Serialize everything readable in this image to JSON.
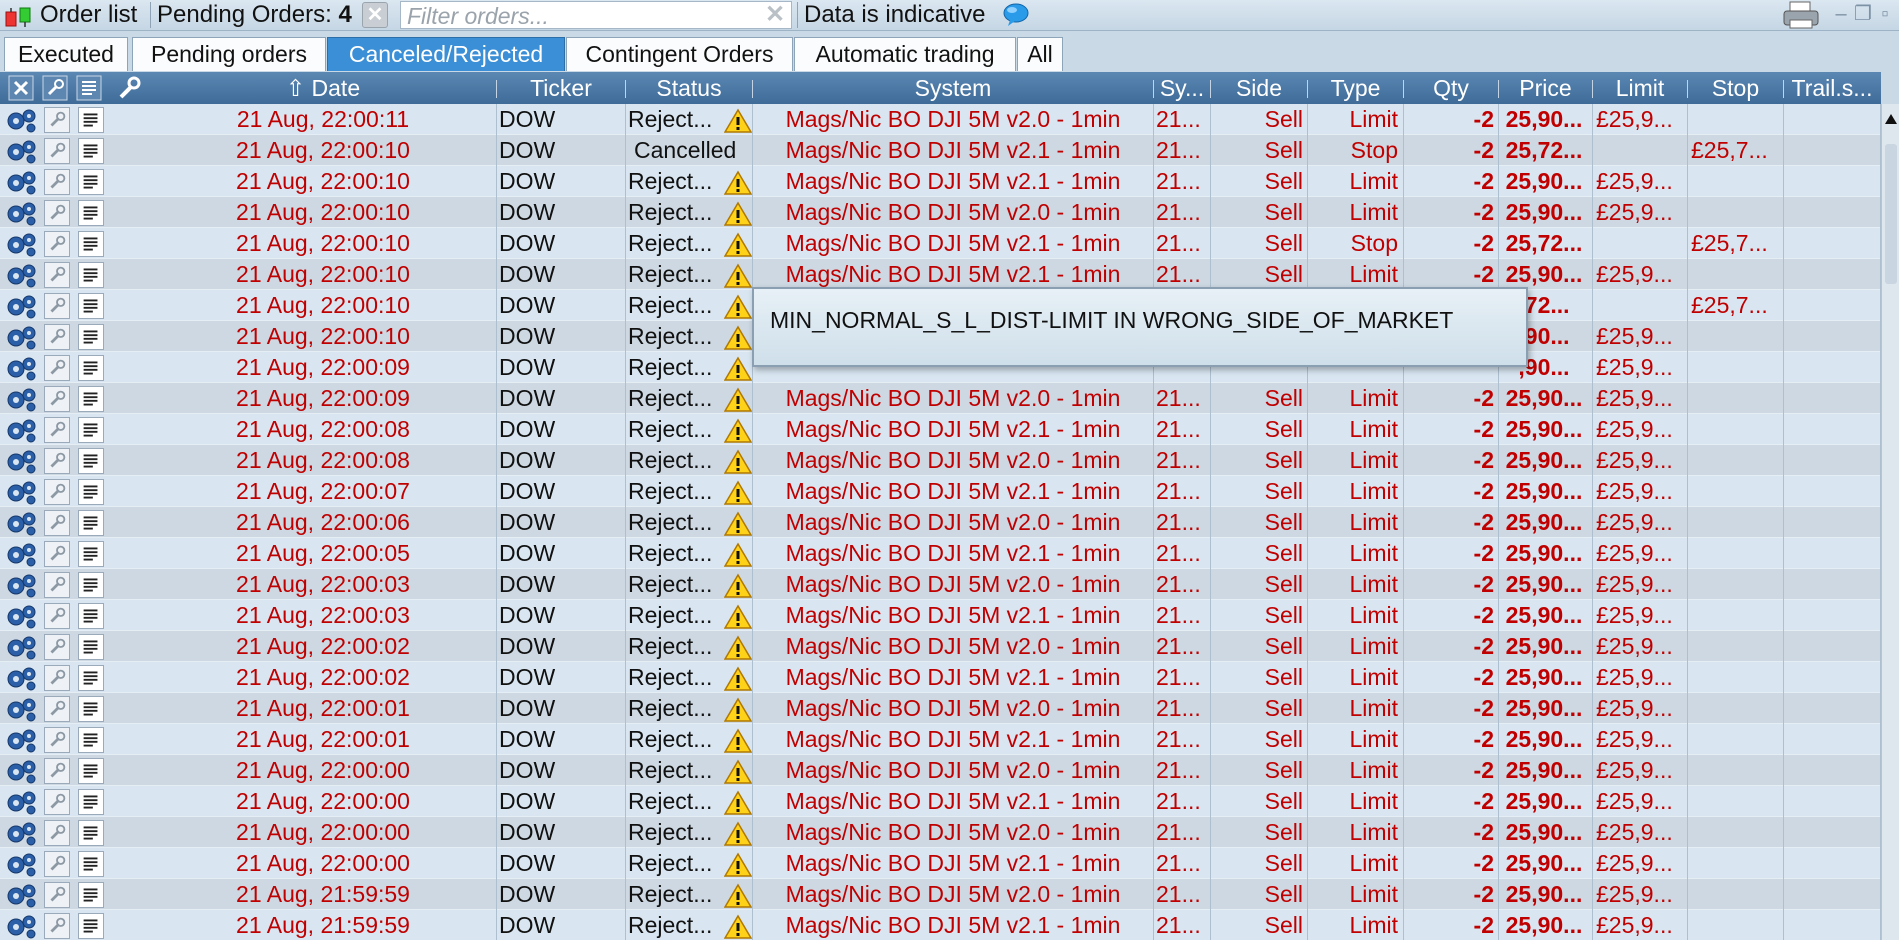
{
  "toolbar": {
    "title": "Order list",
    "pending_label": "Pending Orders:",
    "pending_count": "4",
    "filter_placeholder": "Filter orders...",
    "indicative_text": "Data is indicative"
  },
  "tabs": [
    {
      "label": "Executed",
      "active": false
    },
    {
      "label": "Pending orders",
      "active": false
    },
    {
      "label": "Canceled/Rejected",
      "active": true
    },
    {
      "label": "Contingent Orders",
      "active": false
    },
    {
      "label": "Automatic trading",
      "active": false
    },
    {
      "label": "All",
      "active": false
    }
  ],
  "columns": {
    "date": "Date",
    "ticker": "Ticker",
    "status": "Status",
    "system": "System",
    "sy": "Sy...",
    "side": "Side",
    "type": "Type",
    "qty": "Qty",
    "price": "Price",
    "limit": "Limit",
    "stop": "Stop",
    "trail": "Trail.s..."
  },
  "orders": [
    {
      "date": "21 Aug, 22:00:11",
      "ticker": "DOW",
      "status": "Reject...",
      "warn": true,
      "system": "Mags/Nic BO DJI 5M v2.0 - 1min",
      "sy": "21...",
      "side": "Sell",
      "type": "Limit",
      "qty": "-2",
      "price": "25,90...",
      "limit": "£25,9...",
      "stop": "",
      "trail": ""
    },
    {
      "date": "21 Aug, 22:00:10",
      "ticker": "DOW",
      "status": "Cancelled",
      "warn": false,
      "system": "Mags/Nic BO DJI 5M v2.1 - 1min",
      "sy": "21...",
      "side": "Sell",
      "type": "Stop",
      "qty": "-2",
      "price": "25,72...",
      "limit": "",
      "stop": "£25,7...",
      "trail": ""
    },
    {
      "date": "21 Aug, 22:00:10",
      "ticker": "DOW",
      "status": "Reject...",
      "warn": true,
      "system": "Mags/Nic BO DJI 5M v2.1 - 1min",
      "sy": "21...",
      "side": "Sell",
      "type": "Limit",
      "qty": "-2",
      "price": "25,90...",
      "limit": "£25,9...",
      "stop": "",
      "trail": ""
    },
    {
      "date": "21 Aug, 22:00:10",
      "ticker": "DOW",
      "status": "Reject...",
      "warn": true,
      "system": "Mags/Nic BO DJI 5M v2.0 - 1min",
      "sy": "21...",
      "side": "Sell",
      "type": "Limit",
      "qty": "-2",
      "price": "25,90...",
      "limit": "£25,9...",
      "stop": "",
      "trail": ""
    },
    {
      "date": "21 Aug, 22:00:10",
      "ticker": "DOW",
      "status": "Reject...",
      "warn": true,
      "system": "Mags/Nic BO DJI 5M v2.1 - 1min",
      "sy": "21...",
      "side": "Sell",
      "type": "Stop",
      "qty": "-2",
      "price": "25,72...",
      "limit": "",
      "stop": "£25,7...",
      "trail": ""
    },
    {
      "date": "21 Aug, 22:00:10",
      "ticker": "DOW",
      "status": "Reject...",
      "warn": true,
      "system": "Mags/Nic BO DJI 5M v2.1 - 1min",
      "sy": "21...",
      "side": "Sell",
      "type": "Limit",
      "qty": "-2",
      "price": "25,90...",
      "limit": "£25,9...",
      "stop": "",
      "trail": ""
    },
    {
      "date": "21 Aug, 22:00:10",
      "ticker": "DOW",
      "status": "Reject...",
      "warn": true,
      "system": "",
      "sy": "",
      "side": "",
      "type": "",
      "qty": "",
      "price": ",72...",
      "limit": "",
      "stop": "£25,7...",
      "trail": ""
    },
    {
      "date": "21 Aug, 22:00:10",
      "ticker": "DOW",
      "status": "Reject...",
      "warn": true,
      "system": "",
      "sy": "",
      "side": "",
      "type": "",
      "qty": "",
      "price": ",90...",
      "limit": "£25,9...",
      "stop": "",
      "trail": ""
    },
    {
      "date": "21 Aug, 22:00:09",
      "ticker": "DOW",
      "status": "Reject...",
      "warn": true,
      "system": "",
      "sy": "",
      "side": "",
      "type": "",
      "qty": "",
      "price": ",90...",
      "limit": "£25,9...",
      "stop": "",
      "trail": ""
    },
    {
      "date": "21 Aug, 22:00:09",
      "ticker": "DOW",
      "status": "Reject...",
      "warn": true,
      "system": "Mags/Nic BO DJI 5M v2.0 - 1min",
      "sy": "21...",
      "side": "Sell",
      "type": "Limit",
      "qty": "-2",
      "price": "25,90...",
      "limit": "£25,9...",
      "stop": "",
      "trail": ""
    },
    {
      "date": "21 Aug, 22:00:08",
      "ticker": "DOW",
      "status": "Reject...",
      "warn": true,
      "system": "Mags/Nic BO DJI 5M v2.1 - 1min",
      "sy": "21...",
      "side": "Sell",
      "type": "Limit",
      "qty": "-2",
      "price": "25,90...",
      "limit": "£25,9...",
      "stop": "",
      "trail": ""
    },
    {
      "date": "21 Aug, 22:00:08",
      "ticker": "DOW",
      "status": "Reject...",
      "warn": true,
      "system": "Mags/Nic BO DJI 5M v2.0 - 1min",
      "sy": "21...",
      "side": "Sell",
      "type": "Limit",
      "qty": "-2",
      "price": "25,90...",
      "limit": "£25,9...",
      "stop": "",
      "trail": ""
    },
    {
      "date": "21 Aug, 22:00:07",
      "ticker": "DOW",
      "status": "Reject...",
      "warn": true,
      "system": "Mags/Nic BO DJI 5M v2.1 - 1min",
      "sy": "21...",
      "side": "Sell",
      "type": "Limit",
      "qty": "-2",
      "price": "25,90...",
      "limit": "£25,9...",
      "stop": "",
      "trail": ""
    },
    {
      "date": "21 Aug, 22:00:06",
      "ticker": "DOW",
      "status": "Reject...",
      "warn": true,
      "system": "Mags/Nic BO DJI 5M v2.0 - 1min",
      "sy": "21...",
      "side": "Sell",
      "type": "Limit",
      "qty": "-2",
      "price": "25,90...",
      "limit": "£25,9...",
      "stop": "",
      "trail": ""
    },
    {
      "date": "21 Aug, 22:00:05",
      "ticker": "DOW",
      "status": "Reject...",
      "warn": true,
      "system": "Mags/Nic BO DJI 5M v2.1 - 1min",
      "sy": "21...",
      "side": "Sell",
      "type": "Limit",
      "qty": "-2",
      "price": "25,90...",
      "limit": "£25,9...",
      "stop": "",
      "trail": ""
    },
    {
      "date": "21 Aug, 22:00:03",
      "ticker": "DOW",
      "status": "Reject...",
      "warn": true,
      "system": "Mags/Nic BO DJI 5M v2.0 - 1min",
      "sy": "21...",
      "side": "Sell",
      "type": "Limit",
      "qty": "-2",
      "price": "25,90...",
      "limit": "£25,9...",
      "stop": "",
      "trail": ""
    },
    {
      "date": "21 Aug, 22:00:03",
      "ticker": "DOW",
      "status": "Reject...",
      "warn": true,
      "system": "Mags/Nic BO DJI 5M v2.1 - 1min",
      "sy": "21...",
      "side": "Sell",
      "type": "Limit",
      "qty": "-2",
      "price": "25,90...",
      "limit": "£25,9...",
      "stop": "",
      "trail": ""
    },
    {
      "date": "21 Aug, 22:00:02",
      "ticker": "DOW",
      "status": "Reject...",
      "warn": true,
      "system": "Mags/Nic BO DJI 5M v2.0 - 1min",
      "sy": "21...",
      "side": "Sell",
      "type": "Limit",
      "qty": "-2",
      "price": "25,90...",
      "limit": "£25,9...",
      "stop": "",
      "trail": ""
    },
    {
      "date": "21 Aug, 22:00:02",
      "ticker": "DOW",
      "status": "Reject...",
      "warn": true,
      "system": "Mags/Nic BO DJI 5M v2.1 - 1min",
      "sy": "21...",
      "side": "Sell",
      "type": "Limit",
      "qty": "-2",
      "price": "25,90...",
      "limit": "£25,9...",
      "stop": "",
      "trail": ""
    },
    {
      "date": "21 Aug, 22:00:01",
      "ticker": "DOW",
      "status": "Reject...",
      "warn": true,
      "system": "Mags/Nic BO DJI 5M v2.0 - 1min",
      "sy": "21...",
      "side": "Sell",
      "type": "Limit",
      "qty": "-2",
      "price": "25,90...",
      "limit": "£25,9...",
      "stop": "",
      "trail": ""
    },
    {
      "date": "21 Aug, 22:00:01",
      "ticker": "DOW",
      "status": "Reject...",
      "warn": true,
      "system": "Mags/Nic BO DJI 5M v2.1 - 1min",
      "sy": "21...",
      "side": "Sell",
      "type": "Limit",
      "qty": "-2",
      "price": "25,90...",
      "limit": "£25,9...",
      "stop": "",
      "trail": ""
    },
    {
      "date": "21 Aug, 22:00:00",
      "ticker": "DOW",
      "status": "Reject...",
      "warn": true,
      "system": "Mags/Nic BO DJI 5M v2.0 - 1min",
      "sy": "21...",
      "side": "Sell",
      "type": "Limit",
      "qty": "-2",
      "price": "25,90...",
      "limit": "£25,9...",
      "stop": "",
      "trail": ""
    },
    {
      "date": "21 Aug, 22:00:00",
      "ticker": "DOW",
      "status": "Reject...",
      "warn": true,
      "system": "Mags/Nic BO DJI 5M v2.1 - 1min",
      "sy": "21...",
      "side": "Sell",
      "type": "Limit",
      "qty": "-2",
      "price": "25,90...",
      "limit": "£25,9...",
      "stop": "",
      "trail": ""
    },
    {
      "date": "21 Aug, 22:00:00",
      "ticker": "DOW",
      "status": "Reject...",
      "warn": true,
      "system": "Mags/Nic BO DJI 5M v2.0 - 1min",
      "sy": "21...",
      "side": "Sell",
      "type": "Limit",
      "qty": "-2",
      "price": "25,90...",
      "limit": "£25,9...",
      "stop": "",
      "trail": ""
    },
    {
      "date": "21 Aug, 22:00:00",
      "ticker": "DOW",
      "status": "Reject...",
      "warn": true,
      "system": "Mags/Nic BO DJI 5M v2.1 - 1min",
      "sy": "21...",
      "side": "Sell",
      "type": "Limit",
      "qty": "-2",
      "price": "25,90...",
      "limit": "£25,9...",
      "stop": "",
      "trail": ""
    },
    {
      "date": "21 Aug, 21:59:59",
      "ticker": "DOW",
      "status": "Reject...",
      "warn": true,
      "system": "Mags/Nic BO DJI 5M v2.0 - 1min",
      "sy": "21...",
      "side": "Sell",
      "type": "Limit",
      "qty": "-2",
      "price": "25,90...",
      "limit": "£25,9...",
      "stop": "",
      "trail": ""
    },
    {
      "date": "21 Aug, 21:59:59",
      "ticker": "DOW",
      "status": "Reject...",
      "warn": true,
      "system": "Mags/Nic BO DJI 5M v2.1 - 1min",
      "sy": "21...",
      "side": "Sell",
      "type": "Limit",
      "qty": "-2",
      "price": "25,90...",
      "limit": "£25,9...",
      "stop": "",
      "trail": ""
    }
  ],
  "tooltip": {
    "text": "MIN_NORMAL_S_L_DIST-LIMIT IN WRONG_SIDE_OF_MARKET"
  },
  "colors": {
    "accent_tab": "#3b8fd6",
    "header_bg": "#4a78a6",
    "order_text": "#c00000",
    "row_odd": "#d9e6f1",
    "row_even": "#cdd8e2"
  }
}
